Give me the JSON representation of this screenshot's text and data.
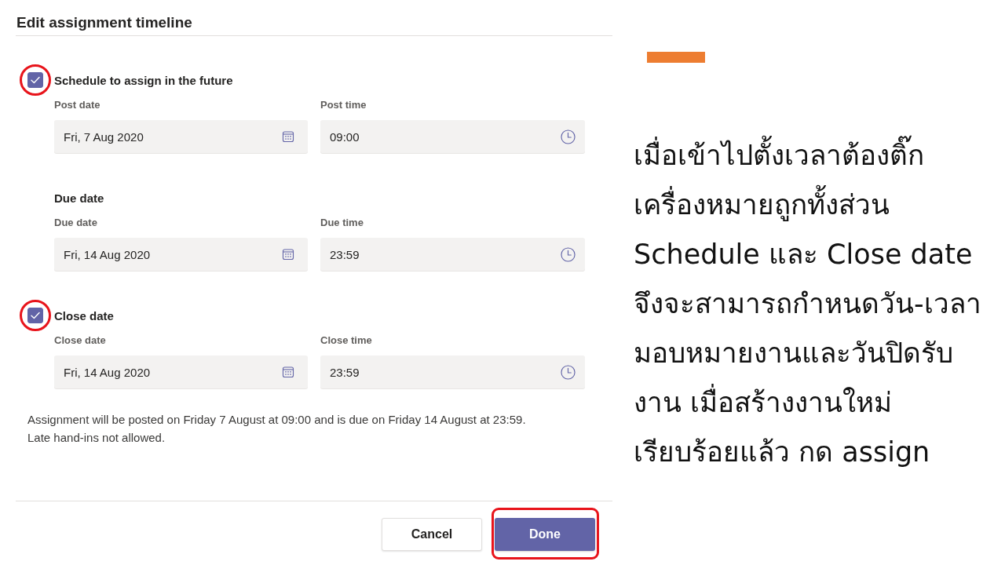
{
  "dialog": {
    "title": "Edit assignment timeline",
    "sections": [
      {
        "kind": "checkbox",
        "label": "Schedule to assign in the future",
        "checked": true,
        "highlighted": true,
        "fields": [
          {
            "kind": "date",
            "label": "Post date",
            "value": "Fri, 7 Aug 2020"
          },
          {
            "kind": "time",
            "label": "Post time",
            "value": "09:00"
          }
        ]
      },
      {
        "kind": "heading",
        "label": "Due date",
        "fields": [
          {
            "kind": "date",
            "label": "Due date",
            "value": "Fri, 14 Aug 2020"
          },
          {
            "kind": "time",
            "label": "Due time",
            "value": "23:59"
          }
        ]
      },
      {
        "kind": "checkbox",
        "label": "Close date",
        "checked": true,
        "highlighted": true,
        "fields": [
          {
            "kind": "date",
            "label": "Close date",
            "value": "Fri, 14 Aug 2020"
          },
          {
            "kind": "time",
            "label": "Close time",
            "value": "23:59"
          }
        ]
      }
    ],
    "summary": [
      "Assignment will be posted on Friday 7 August at 09:00 and is due on Friday 14 August at 23:59.",
      "Late hand-ins not allowed."
    ],
    "buttons": [
      {
        "kind": "secondary",
        "label": "Cancel",
        "highlighted": false
      },
      {
        "kind": "primary",
        "label": "Done",
        "highlighted": true
      }
    ]
  },
  "caption": {
    "lines": [
      "เมื่อเข้าไปตั้งเวลาต้องติ๊ก",
      "เครื่องหมายถูกทั้งส่วน",
      "Schedule และ Close date",
      "จึงจะสามารถกำหนดวัน-เวลา",
      "มอบหมายงานและวันปิดรับ",
      "งาน เมื่อสร้างงานใหม่",
      "เรียบร้อยแล้ว กด assign"
    ]
  }
}
